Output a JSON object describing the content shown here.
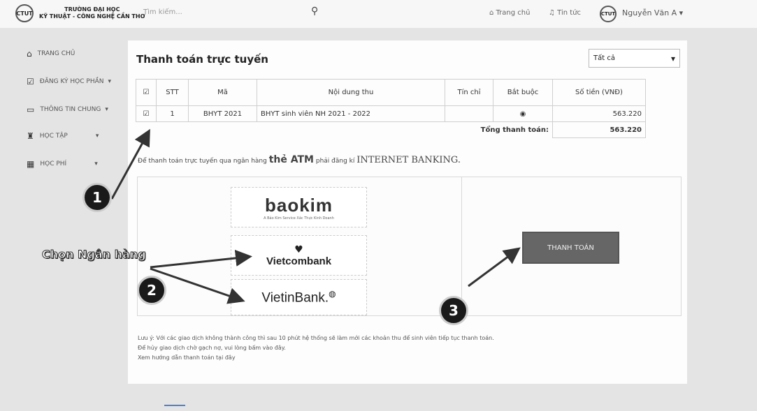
{
  "header": {
    "school_line1": "TRƯỜNG ĐẠI HỌC",
    "school_line2": "KỸ THUẬT - CÔNG NGHỆ CẦN THƠ",
    "logo_text": "CTUT",
    "search_placeholder": "Tìm kiếm...",
    "home_link": "Trang chủ",
    "news_link": "Tin tức",
    "user_name": "Nguyễn Văn A"
  },
  "sidebar": {
    "items": [
      {
        "label": "TRANG CHỦ"
      },
      {
        "label": "ĐĂNG KÝ HỌC PHẦN"
      },
      {
        "label": "THÔNG TIN CHUNG"
      },
      {
        "label": "HỌC TẬP"
      },
      {
        "label": "HỌC PHÍ"
      }
    ]
  },
  "main": {
    "title": "Thanh toán trực tuyến",
    "filter_selected": "Tất cả",
    "table": {
      "headers": [
        "STT",
        "Mã",
        "Nội dung thu",
        "Tín chỉ",
        "Bắt buộc",
        "Số tiền (VNĐ)"
      ],
      "rows": [
        {
          "stt": "1",
          "ma": "BHYT 2021",
          "noi_dung": "BHYT sinh viên NH 2021 - 2022",
          "tin_chi": "",
          "amount": "563.220"
        }
      ],
      "total_label": "Tổng thanh toán:",
      "total_value": "563.220"
    },
    "notice_prefix": "Để thanh toán trực tuyến qua ngân hàng",
    "notice_atm": "thẻ ATM",
    "notice_mid": "phải đăng kí",
    "notice_banking": "INTERNET BANKING.",
    "banks": [
      {
        "name": "baokim",
        "tagline": "A Bảo Kim Service Xác Thực Kinh Doanh"
      },
      {
        "name": "Vietcombank"
      },
      {
        "name": "VietinBank."
      }
    ],
    "pay_button": "THANH TOÁN",
    "notes": [
      "Lưu ý: Với các giao dịch không thành công thì sau 10 phút hệ thống sẽ làm mới các khoản thu để sinh viên tiếp tục thanh toán.",
      "Để hủy giao dịch chờ gạch nợ, vui lòng bấm vào đây.",
      "Xem hướng dẫn thanh toán tại đây"
    ]
  },
  "annotations": {
    "step1": "1",
    "step2": "2",
    "step3": "3",
    "choose_bank": "Chọn Ngân hàng"
  },
  "colors": {
    "pay_button": "#666666",
    "background": "#e4e4e4"
  }
}
